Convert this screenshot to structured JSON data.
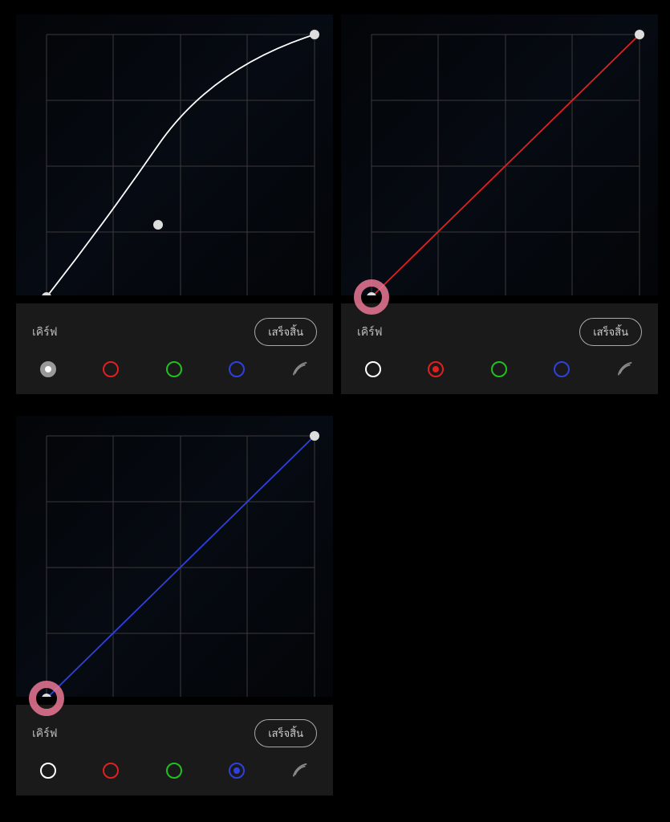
{
  "panels": {
    "top_left": {
      "label": "เคิร์ฟ",
      "done": "เสร็จสิ้น",
      "active_channel": "white"
    },
    "top_right": {
      "label": "เคิร์ฟ",
      "done": "เสร็จสิ้น",
      "active_channel": "red"
    },
    "bottom_left": {
      "label": "เคิร์ฟ",
      "done": "เสร็จสิ้น",
      "active_channel": "blue"
    }
  },
  "channels": [
    "white",
    "red",
    "green",
    "blue"
  ],
  "colors": {
    "white": "#ffffff",
    "red": "#e02020",
    "green": "#20c020",
    "blue": "#3040e0",
    "grid": "#3a3a3a",
    "highlight_ring": "rgba(235,120,150,0.85)"
  },
  "chart_data": [
    {
      "type": "line",
      "title": "Luma curve (white channel)",
      "xlim": [
        0,
        255
      ],
      "ylim": [
        0,
        255
      ],
      "grid_divisions": 4,
      "series": [
        {
          "name": "white",
          "color": "#ffffff",
          "points": [
            {
              "x": 0,
              "y": 0
            },
            {
              "x": 106,
              "y": 148
            },
            {
              "x": 255,
              "y": 255
            }
          ]
        }
      ]
    },
    {
      "type": "line",
      "title": "Red channel curve",
      "xlim": [
        0,
        255
      ],
      "ylim": [
        0,
        255
      ],
      "grid_divisions": 4,
      "highlighted_point_index": 0,
      "series": [
        {
          "name": "red",
          "color": "#e02020",
          "points": [
            {
              "x": 0,
              "y": 0
            },
            {
              "x": 255,
              "y": 255
            }
          ]
        }
      ]
    },
    {
      "type": "line",
      "title": "Blue channel curve",
      "xlim": [
        0,
        255
      ],
      "ylim": [
        0,
        255
      ],
      "grid_divisions": 4,
      "highlighted_point_index": 0,
      "series": [
        {
          "name": "blue",
          "color": "#3040e0",
          "points": [
            {
              "x": 0,
              "y": 0
            },
            {
              "x": 255,
              "y": 255
            }
          ]
        }
      ]
    }
  ]
}
